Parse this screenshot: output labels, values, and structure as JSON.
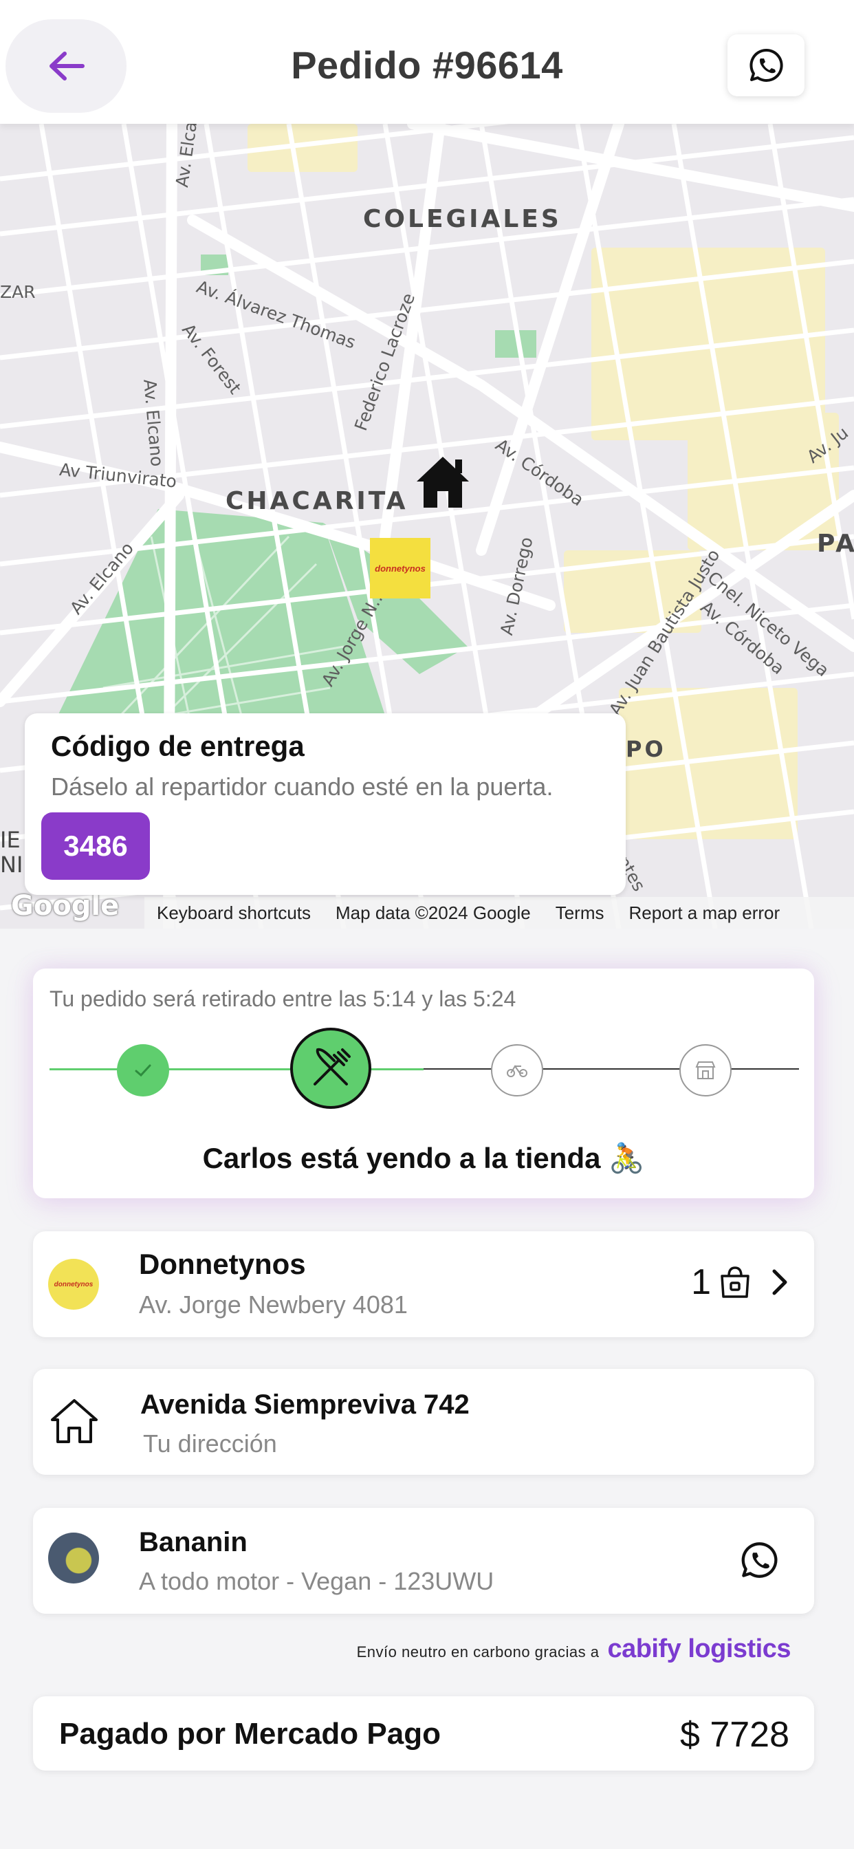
{
  "header": {
    "title": "Pedido #96614",
    "back_icon": "arrow-left-icon",
    "whatsapp_icon": "whatsapp-icon"
  },
  "map": {
    "districts": [
      "COLEGIALES",
      "CHACARITA",
      "PA",
      "PO"
    ],
    "streets": {
      "elcano_top": "Av. Elca...",
      "zar": "ZAR",
      "alvarez_thomas": "Av. Álvarez Thomas",
      "elcano": "Av. Elcano",
      "forest": "Av. Forest",
      "lacroze": "Federico Lacroze",
      "cordoba": "Av. Córdoba",
      "triunvirato": "Av Triunvirato",
      "elcano_low": "Av. Elcano",
      "jorge_n": "Av. Jorge N...",
      "dorrego": "Av. Dorrego",
      "juan_b_justo": "Av. Juan Bautista Justo",
      "niceto_vega": "Cnel. Niceto Vega",
      "cordoba2": "Av. Córdoba",
      "av_ju": "Av. Ju",
      "ientes": "ientes",
      "ie": "IE",
      "ni": "NI"
    },
    "attribution": {
      "logo": "Google",
      "keyboard": "Keyboard shortcuts",
      "data": "Map data ©2024 Google",
      "terms": "Terms",
      "report": "Report a map error"
    },
    "store_pin_text": "donnetynos"
  },
  "delivery_code": {
    "title": "Código de entrega",
    "subtitle": "Dáselo al repartidor cuando esté en la puerta.",
    "code": "3486"
  },
  "status": {
    "time_window": "Tu pedido será retirado entre las 5:14 y las 5:24",
    "message": "Carlos está yendo a la tienda 🚴",
    "steps": [
      {
        "name": "confirmed",
        "icon": "check-icon",
        "state": "done"
      },
      {
        "name": "preparing",
        "icon": "fork-knife-icon",
        "state": "current"
      },
      {
        "name": "on-the-way",
        "icon": "bicycle-icon",
        "state": "pending"
      },
      {
        "name": "delivered",
        "icon": "store-icon",
        "state": "pending"
      }
    ],
    "accent": "#5fce6e"
  },
  "store": {
    "name": "Donnetynos",
    "address": "Av. Jorge Newbery 4081",
    "items_count": "1",
    "logo_text": "donnetynos"
  },
  "destination": {
    "address": "Avenida Siempreviva 742",
    "label": "Tu dirección"
  },
  "rider": {
    "name": "Bananin",
    "vehicle": "A todo motor - Vegan - 123UWU"
  },
  "carbon": {
    "text": "Envío neutro en carbono gracias a",
    "brand": "cabify logistics",
    "brand_color": "#7b3bd0"
  },
  "payment": {
    "label": "Pagado por Mercado Pago",
    "amount": "$ 7728"
  },
  "colors": {
    "brand": "#8a3bc9",
    "success": "#5fce6e",
    "background": "#f4f4f6"
  }
}
